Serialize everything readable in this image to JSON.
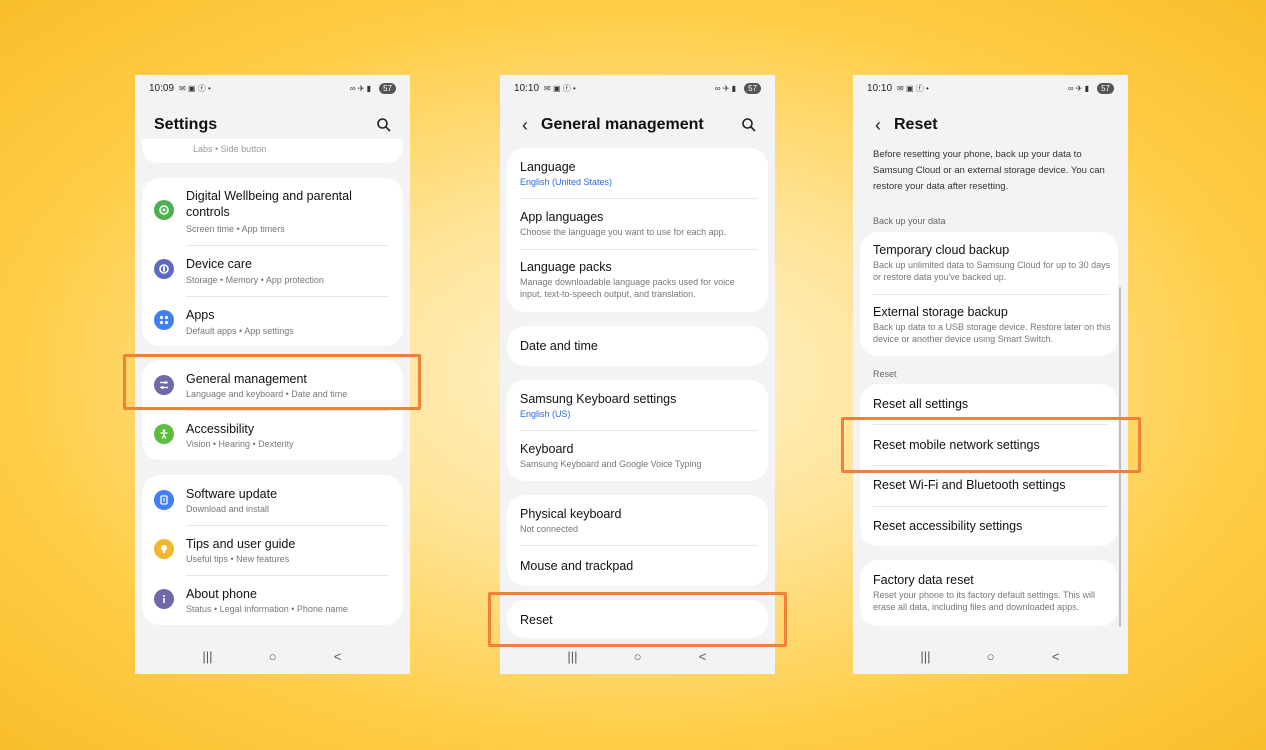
{
  "status": {
    "p1_time": "10:09",
    "p2_time": "10:10",
    "p3_time": "10:10",
    "battery": "57"
  },
  "settings": {
    "title": "Settings",
    "top_partial": "Labs  •  Side button",
    "items": [
      {
        "title": "Digital Wellbeing and parental controls",
        "subtitle": "Screen time  •  App timers",
        "color": "#4caf50",
        "icon": "wellbeing-icon"
      },
      {
        "title": "Device care",
        "subtitle": "Storage  •  Memory  •  App protection",
        "color": "#5c6bc0",
        "icon": "device-care-icon"
      },
      {
        "title": "Apps",
        "subtitle": "Default apps  •  App settings",
        "color": "#3f7ef3",
        "icon": "apps-icon"
      },
      {
        "title": "General management",
        "subtitle": "Language and keyboard  •  Date and time",
        "color": "#6e6aa8",
        "icon": "sliders-icon"
      },
      {
        "title": "Accessibility",
        "subtitle": "Vision  •  Hearing  •  Dexterity",
        "color": "#5ebd3f",
        "icon": "accessibility-icon"
      },
      {
        "title": "Software update",
        "subtitle": "Download and install",
        "color": "#3f7ef3",
        "icon": "update-icon"
      },
      {
        "title": "Tips and user guide",
        "subtitle": "Useful tips  •  New features",
        "color": "#f2b631",
        "icon": "bulb-icon"
      },
      {
        "title": "About phone",
        "subtitle": "Status  •  Legal information  •  Phone name",
        "color": "#6e6aa8",
        "icon": "info-icon"
      }
    ]
  },
  "general": {
    "title": "General management",
    "items": [
      {
        "title": "Language",
        "subtitle": "English (United States)"
      },
      {
        "title": "App languages",
        "subtitle": "Choose the language you want to use for each app."
      },
      {
        "title": "Language packs",
        "subtitle": "Manage downloadable language packs used for voice input, text-to-speech output, and translation."
      },
      {
        "title": "Date and time"
      },
      {
        "title": "Samsung Keyboard settings",
        "subtitle": "English (US)"
      },
      {
        "title": "Keyboard",
        "subtitle": "Samsung Keyboard and Google Voice Typing"
      },
      {
        "title": "Physical keyboard",
        "subtitle": "Not connected"
      },
      {
        "title": "Mouse and trackpad"
      },
      {
        "title": "Reset"
      }
    ]
  },
  "reset": {
    "title": "Reset",
    "intro": "Before resetting your phone, back up your data to Samsung Cloud or an external storage device. You can restore your data after resetting.",
    "backup_label": "Back up your data",
    "reset_label": "Reset",
    "items": [
      {
        "title": "Temporary cloud backup",
        "subtitle": "Back up unlimited data to Samsung Cloud for up to 30 days or restore data you've backed up."
      },
      {
        "title": "External storage backup",
        "subtitle": "Back up data to a USB storage device. Restore later on this device or another device using Smart Switch."
      },
      {
        "title": "Reset all settings"
      },
      {
        "title": "Reset mobile network settings"
      },
      {
        "title": "Reset Wi-Fi and Bluetooth settings"
      },
      {
        "title": "Reset accessibility settings"
      },
      {
        "title": "Factory data reset",
        "subtitle": "Reset your phone to its factory default settings. This will erase all data, including files and downloaded apps."
      }
    ]
  },
  "navbar": {
    "recents": "|||",
    "home": "○",
    "back": "<"
  },
  "colors": {
    "highlight": "#f0803a",
    "link_blue": "#2c6bd6"
  }
}
